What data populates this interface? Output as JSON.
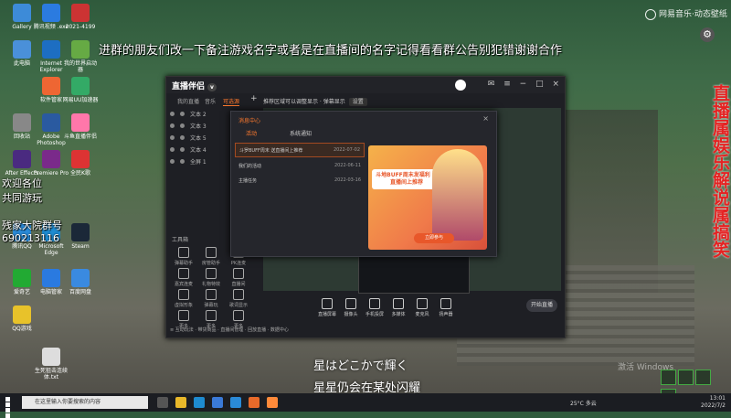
{
  "notice": "进群的朋友们改一下备注游戏名字或者是在直播间的名字记得看看群公告别犯错谢谢合作",
  "brand": "网易音乐·动态壁纸",
  "vertical_banner": "直播属娱乐解说属搞笑",
  "left_overlay": {
    "line1": "欢迎各位",
    "line2": "共同游玩",
    "line3": "残家大院群号",
    "line4": "690213116"
  },
  "desktop_icons": [
    {
      "label": "Gallery",
      "color": "#3d8bd8"
    },
    {
      "label": "腾讯视频 .exe",
      "color": "#2b7be0"
    },
    {
      "label": "2021-4199",
      "color": "#c33"
    },
    {
      "label": "此电脑",
      "color": "#4a90d9"
    },
    {
      "label": "Internet Explorer",
      "color": "#1d6ec2"
    },
    {
      "label": "我的世界启动器",
      "color": "#6a4"
    },
    {
      "label": "软件管家",
      "color": "#e63"
    },
    {
      "label": "网易UU加速器",
      "color": "#3a6"
    },
    {
      "label": "回收站",
      "color": "#888"
    },
    {
      "label": "Adobe Photoshop",
      "color": "#2a5aa0"
    },
    {
      "label": "斗鱼直播伴侣",
      "color": "#f7a"
    },
    {
      "label": "After Effects",
      "color": "#4a2a80"
    },
    {
      "label": "Premiere Pro",
      "color": "#7a2a8a"
    },
    {
      "label": "全民K歌",
      "color": "#d33"
    },
    {
      "label": "腾讯QQ",
      "color": "#2a8ad8"
    },
    {
      "label": "Microsoft Edge",
      "color": "#1e8bd0"
    },
    {
      "label": "Steam",
      "color": "#1b2838"
    },
    {
      "label": "爱奇艺",
      "color": "#2a3"
    },
    {
      "label": "电脑管家",
      "color": "#2a7ae0"
    },
    {
      "label": "百度网盘",
      "color": "#3a8ae0"
    },
    {
      "label": "QQ游戏",
      "color": "#e8c22a"
    },
    {
      "label": "生死狙击连续体.txt",
      "color": "#ddd"
    }
  ],
  "app": {
    "logo": "直播伴侣",
    "version": "v",
    "tabs": [
      "我的直播",
      "音乐",
      "可选源"
    ],
    "layers": [
      "文本 2",
      "文本 3",
      "文本 5",
      "文本 4",
      "全屏 1"
    ],
    "toolbox_title": "工具箱",
    "tools": [
      "弹幕助手",
      "房管助手",
      "PK连麦",
      "嘉宾连麦",
      "礼物特效",
      "直播间",
      "虚拟形象",
      "弹幕玩",
      "歌词显示",
      "更多",
      "更多",
      "更多"
    ],
    "preview_bar": "推荐区域可以调整显示 · 弹幕显示",
    "preview_btn": "设置",
    "bottom_tools": [
      "直播屏幕",
      "摄像头",
      "手机投屏",
      "多媒体",
      "麦克风",
      "扬声器"
    ],
    "start_label": "开始直播",
    "status": "≡ 互动玩法 · 带货商品 · 直播间管理 · 回放直播 · 数据中心"
  },
  "modal": {
    "title": "消息中心",
    "close": "×",
    "tabs": [
      "活动",
      "系统通知"
    ],
    "rows": [
      {
        "text": "斗罗BUFF周末 送直播间上推荐",
        "date": "2022-07-02"
      },
      {
        "text": "我们的活动",
        "date": "2022-06-11"
      },
      {
        "text": "主播任务",
        "date": "2022-03-16"
      }
    ],
    "banner_text": "斗地BUFF周末发福利 送直播间上推荐",
    "banner_cta": "立即参与"
  },
  "subtitle_jp": "星はどこかで輝く",
  "subtitle_cn": "星星仍会在某处闪耀",
  "windows_watermark": "激活 Windows",
  "taskbar": {
    "search_placeholder": "在这里输入你要搜索的内容",
    "weather": "25°C 多云",
    "time": "13:01",
    "date": "2022/7/2"
  }
}
